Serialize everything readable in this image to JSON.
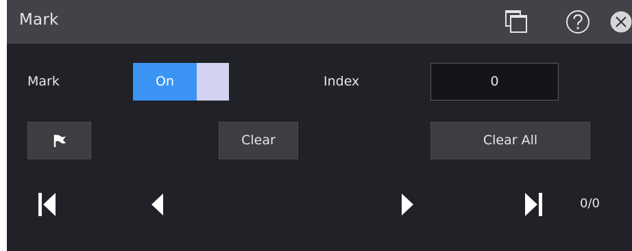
{
  "dialog": {
    "title": "Mark",
    "icons": {
      "window": "windows-icon",
      "help": "help-icon",
      "close": "close-icon"
    }
  },
  "mark": {
    "label": "Mark",
    "toggle_state": "On",
    "toggle_enabled": true
  },
  "index": {
    "label": "Index",
    "value": "0"
  },
  "buttons": {
    "flag_icon": "flag-icon",
    "clear": "Clear",
    "clear_all": "Clear All"
  },
  "navigation": {
    "first_icon": "skip-first-icon",
    "prev_icon": "previous-icon",
    "next_icon": "next-icon",
    "last_icon": "skip-last-icon",
    "counter": "0/0"
  },
  "colors": {
    "background": "#212128",
    "titlebar": "#424248",
    "accent": "#3b94f4",
    "toggle_knob": "#d2d3f1",
    "button": "#3d3d42",
    "text": "#e6e6e6"
  }
}
